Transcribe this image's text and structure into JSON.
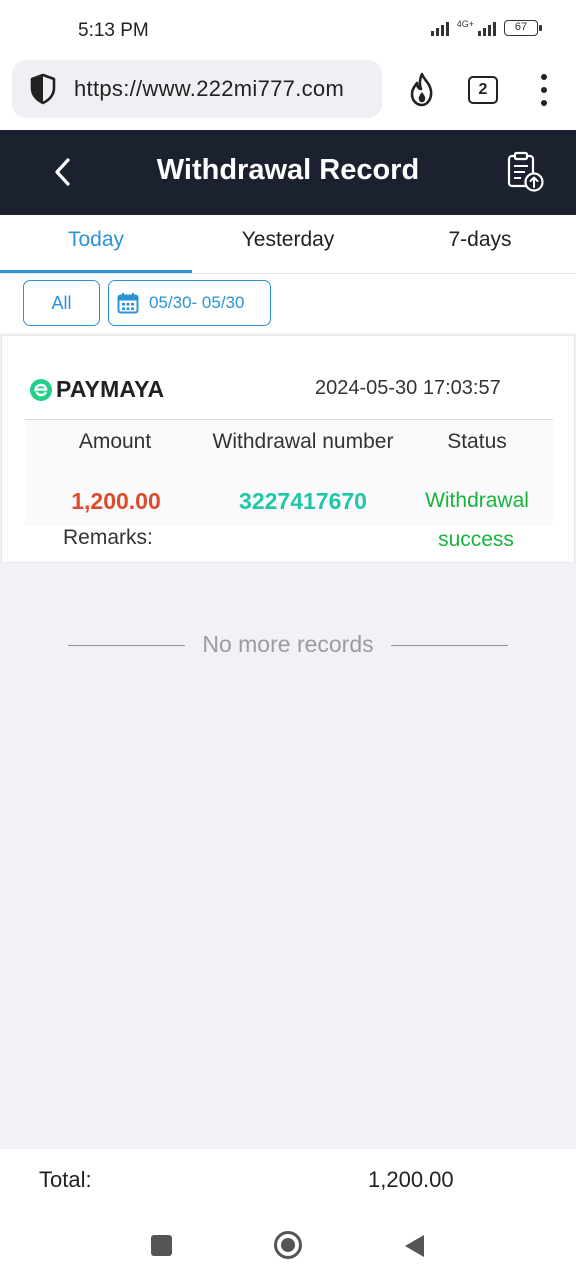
{
  "status_bar": {
    "time": "5:13 PM",
    "network": "4G+",
    "battery": "67"
  },
  "browser": {
    "url": "https://www.222mi777.com",
    "tab_count": "2"
  },
  "header": {
    "title": "Withdrawal Record"
  },
  "tabs": [
    {
      "label": "Today",
      "active": true
    },
    {
      "label": "Yesterday",
      "active": false
    },
    {
      "label": "7-days",
      "active": false
    }
  ],
  "filters": {
    "all_label": "All",
    "date_range": "05/30- 05/30"
  },
  "record": {
    "method": "PAYMAYA",
    "datetime": "2024-05-30 17:03:57",
    "columns": {
      "amount": "Amount",
      "number": "Withdrawal number",
      "status": "Status"
    },
    "amount": "1,200.00",
    "withdrawal_number": "3227417670",
    "status_line1": "Withdrawal",
    "status_line2": "success",
    "remarks_label": "Remarks:"
  },
  "list_end": "No more records",
  "footer": {
    "total_label": "Total:",
    "total_value": "1,200.00"
  },
  "colors": {
    "header_bg": "#1c2130",
    "accent": "#2a93d5",
    "amount_red": "#e04a2c",
    "number_teal": "#1fc7a7",
    "status_green": "#16b43c"
  }
}
